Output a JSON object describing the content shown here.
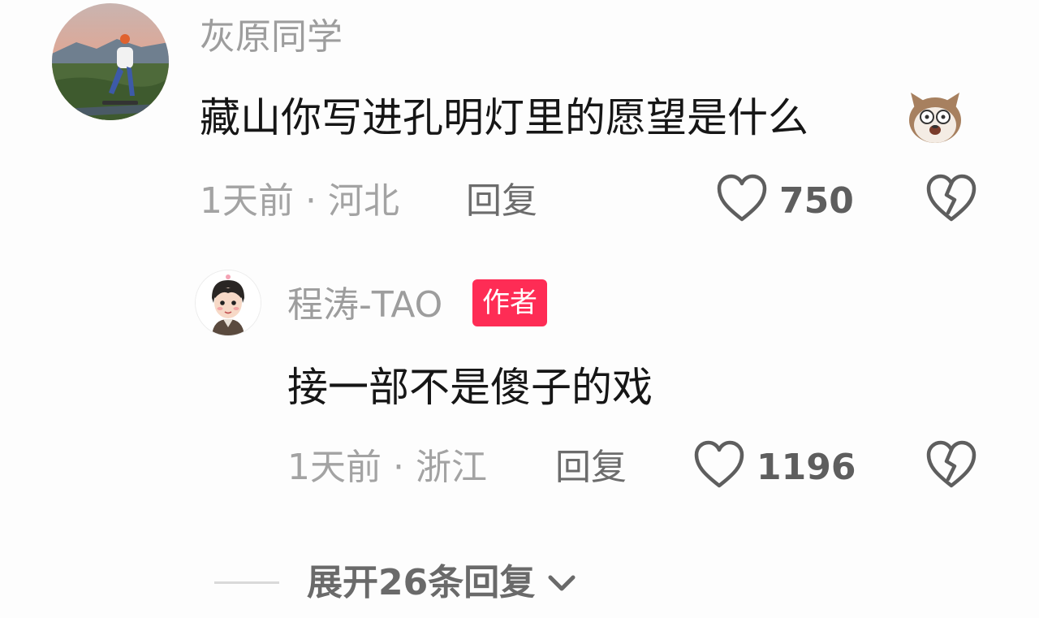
{
  "comment": {
    "username": "灰原同学",
    "text": "藏山你写进孔明灯里的愿望是什么",
    "emoji_icon": "dog-face-emoji-icon",
    "meta": "1天前 · 河北",
    "reply_label": "回复",
    "like_count": "750"
  },
  "reply": {
    "username": "程涛-TAO",
    "badge": "作者",
    "text": "接一部不是傻子的戏",
    "meta": "1天前 · 浙江",
    "reply_label": "回复",
    "like_count": "1196"
  },
  "expand": {
    "label": "展开26条回复"
  },
  "colors": {
    "badge": "#fe2c55",
    "background": "#fdfdfd",
    "primary_text": "#161616",
    "secondary_text": "#9d9d9d"
  }
}
